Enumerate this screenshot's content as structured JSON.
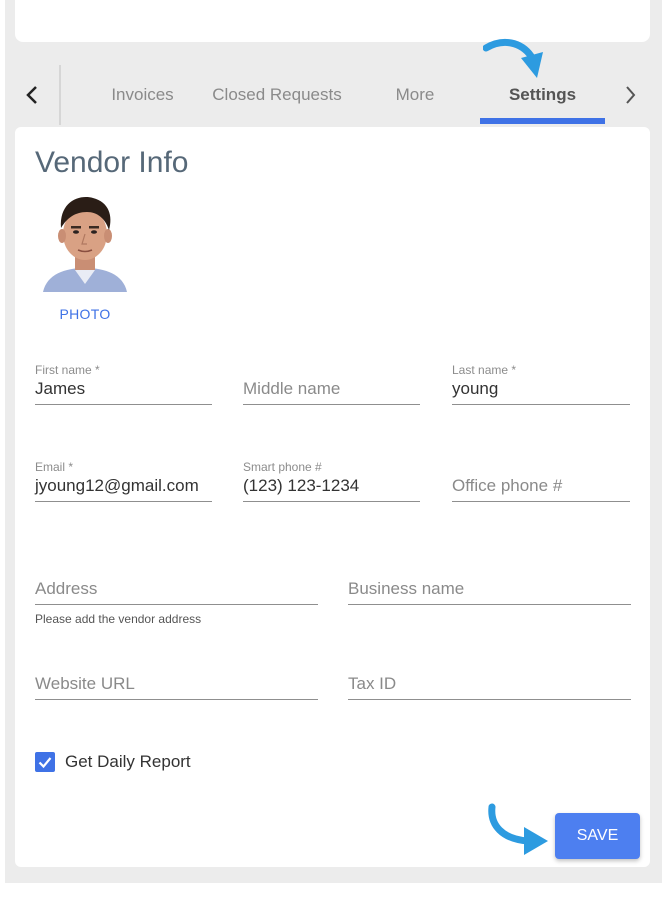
{
  "tabs": [
    {
      "label": "Invoices"
    },
    {
      "label": "Closed Requests"
    },
    {
      "label": "More"
    },
    {
      "label": "Settings",
      "active": true
    }
  ],
  "page_title": "Vendor Info",
  "photo": {
    "label": "PHOTO"
  },
  "fields": {
    "first_name": {
      "label": "First name *",
      "value": "James"
    },
    "middle_name": {
      "placeholder": "Middle name"
    },
    "last_name": {
      "label": "Last name *",
      "value": "young"
    },
    "email": {
      "label": "Email *",
      "value": "jyoung12@gmail.com"
    },
    "smart_phone": {
      "label": "Smart phone #",
      "value": "(123) 123-1234"
    },
    "office_phone": {
      "placeholder": "Office phone #"
    },
    "address": {
      "placeholder": "Address",
      "help": "Please add the vendor address"
    },
    "business_name": {
      "placeholder": "Business name"
    },
    "website_url": {
      "placeholder": "Website URL"
    },
    "tax_id": {
      "placeholder": "Tax ID"
    }
  },
  "daily_report": {
    "label": "Get Daily Report",
    "checked": true
  },
  "save_button": {
    "label": "SAVE"
  },
  "colors": {
    "accent": "#3f72e6",
    "pointer_arrow": "#2d9be0",
    "title": "#566878"
  }
}
